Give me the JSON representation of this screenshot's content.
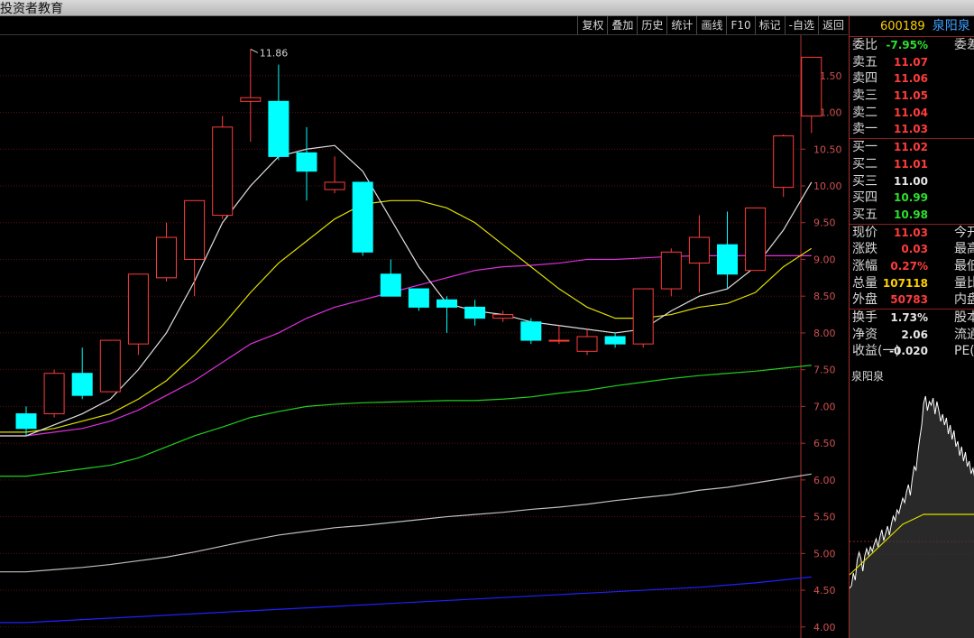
{
  "app": {
    "title": "投资者教育"
  },
  "toolbar": {
    "buttons": [
      "复权",
      "叠加",
      "历史",
      "统计",
      "画线",
      "F10",
      "标记",
      "-自选",
      "返回"
    ]
  },
  "chart": {
    "high_label": "11.86",
    "y_ticks": [
      "11.50",
      "11.00",
      "10.50",
      "10.00",
      "9.50",
      "9.00",
      "8.50",
      "8.00",
      "7.50",
      "7.00",
      "6.50",
      "6.00",
      "5.50",
      "5.00",
      "4.50",
      "4.00"
    ],
    "colors": {
      "up": "#ff3c3c",
      "down": "#00ffff",
      "ma5": "#e0e0e0",
      "ma10": "#e0e000",
      "ma20": "#e030e0",
      "ma60": "#20d020",
      "ma120": "#c0c0c0",
      "ma250": "#2020ff"
    }
  },
  "chart_data": {
    "type": "candlestick",
    "ylim": [
      3.85,
      12.05
    ],
    "candles": [
      {
        "o": 6.9,
        "h": 7.0,
        "l": 6.6,
        "c": 6.7
      },
      {
        "o": 6.9,
        "h": 7.5,
        "l": 6.85,
        "c": 7.45
      },
      {
        "o": 7.45,
        "h": 7.8,
        "l": 7.1,
        "c": 7.15
      },
      {
        "o": 7.2,
        "h": 7.9,
        "l": 7.2,
        "c": 7.9
      },
      {
        "o": 7.85,
        "h": 8.8,
        "l": 7.7,
        "c": 8.8
      },
      {
        "o": 8.75,
        "h": 9.5,
        "l": 8.7,
        "c": 9.3
      },
      {
        "o": 9.0,
        "h": 9.8,
        "l": 8.5,
        "c": 9.8
      },
      {
        "o": 9.6,
        "h": 10.95,
        "l": 9.55,
        "c": 10.8
      },
      {
        "o": 11.15,
        "h": 11.86,
        "l": 10.6,
        "c": 11.2
      },
      {
        "o": 11.15,
        "h": 11.65,
        "l": 10.35,
        "c": 10.4
      },
      {
        "o": 10.45,
        "h": 10.8,
        "l": 9.8,
        "c": 10.2
      },
      {
        "o": 9.95,
        "h": 10.4,
        "l": 9.9,
        "c": 10.05
      },
      {
        "o": 10.05,
        "h": 10.05,
        "l": 9.05,
        "c": 9.1
      },
      {
        "o": 8.8,
        "h": 9.0,
        "l": 8.5,
        "c": 8.5
      },
      {
        "o": 8.6,
        "h": 8.6,
        "l": 8.3,
        "c": 8.35
      },
      {
        "o": 8.45,
        "h": 8.5,
        "l": 8.0,
        "c": 8.35
      },
      {
        "o": 8.35,
        "h": 8.45,
        "l": 8.1,
        "c": 8.2
      },
      {
        "o": 8.2,
        "h": 8.3,
        "l": 8.15,
        "c": 8.25
      },
      {
        "o": 8.15,
        "h": 8.2,
        "l": 7.85,
        "c": 7.9
      },
      {
        "o": 7.9,
        "h": 8.1,
        "l": 7.85,
        "c": 7.9
      },
      {
        "o": 7.75,
        "h": 8.05,
        "l": 7.7,
        "c": 7.95
      },
      {
        "o": 7.95,
        "h": 8.0,
        "l": 7.8,
        "c": 7.85
      },
      {
        "o": 7.85,
        "h": 8.6,
        "l": 7.8,
        "c": 8.6
      },
      {
        "o": 8.6,
        "h": 9.15,
        "l": 8.5,
        "c": 9.1
      },
      {
        "o": 8.95,
        "h": 9.6,
        "l": 8.55,
        "c": 9.3
      },
      {
        "o": 9.2,
        "h": 9.65,
        "l": 8.6,
        "c": 8.8
      },
      {
        "o": 8.85,
        "h": 9.7,
        "l": 8.85,
        "c": 9.7
      },
      {
        "o": 9.98,
        "h": 10.7,
        "l": 9.85,
        "c": 10.68
      },
      {
        "o": 10.95,
        "h": 11.75,
        "l": 10.72,
        "c": 11.75
      }
    ],
    "ma5": [
      6.6,
      6.75,
      6.9,
      7.1,
      7.5,
      8.0,
      8.7,
      9.5,
      10.0,
      10.4,
      10.5,
      10.55,
      10.2,
      9.55,
      8.9,
      8.4,
      8.3,
      8.25,
      8.15,
      8.1,
      8.05,
      8.0,
      8.05,
      8.3,
      8.5,
      8.6,
      8.9,
      9.4,
      10.05
    ],
    "ma10": [
      6.65,
      6.7,
      6.8,
      6.9,
      7.1,
      7.35,
      7.7,
      8.1,
      8.55,
      8.95,
      9.25,
      9.55,
      9.75,
      9.8,
      9.8,
      9.7,
      9.5,
      9.2,
      8.9,
      8.6,
      8.35,
      8.2,
      8.2,
      8.25,
      8.35,
      8.4,
      8.55,
      8.9,
      9.15
    ],
    "ma20": [
      6.6,
      6.65,
      6.7,
      6.8,
      6.95,
      7.15,
      7.35,
      7.6,
      7.85,
      8.0,
      8.2,
      8.35,
      8.45,
      8.55,
      8.65,
      8.75,
      8.85,
      8.9,
      8.92,
      8.95,
      9.0,
      9.0,
      9.02,
      9.04,
      9.05,
      9.05,
      9.05,
      9.05,
      9.05
    ],
    "ma60": [
      6.05,
      6.1,
      6.15,
      6.2,
      6.3,
      6.45,
      6.6,
      6.72,
      6.85,
      6.93,
      7.0,
      7.03,
      7.05,
      7.06,
      7.07,
      7.08,
      7.08,
      7.1,
      7.13,
      7.18,
      7.22,
      7.28,
      7.33,
      7.38,
      7.42,
      7.45,
      7.48,
      7.52,
      7.56
    ],
    "ma120": [
      4.75,
      4.78,
      4.81,
      4.85,
      4.9,
      4.95,
      5.02,
      5.1,
      5.18,
      5.25,
      5.3,
      5.35,
      5.38,
      5.42,
      5.46,
      5.5,
      5.53,
      5.56,
      5.6,
      5.63,
      5.67,
      5.72,
      5.76,
      5.8,
      5.86,
      5.9,
      5.96,
      6.02,
      6.08
    ],
    "ma250": [
      4.06,
      4.08,
      4.1,
      4.12,
      4.14,
      4.16,
      4.18,
      4.2,
      4.22,
      4.24,
      4.26,
      4.28,
      4.3,
      4.32,
      4.34,
      4.36,
      4.38,
      4.4,
      4.42,
      4.44,
      4.46,
      4.48,
      4.5,
      4.52,
      4.54,
      4.57,
      4.6,
      4.64,
      4.68
    ]
  },
  "quote": {
    "code": "600189",
    "name": "泉阳泉",
    "rows": [
      {
        "label": "委比",
        "value": "-7.95%",
        "color": "green",
        "extra": "委差"
      },
      {
        "label": "卖五",
        "value": "11.07",
        "color": "red",
        "extra": ""
      },
      {
        "label": "卖四",
        "value": "11.06",
        "color": "red",
        "extra": ""
      },
      {
        "label": "卖三",
        "value": "11.05",
        "color": "red",
        "extra": ""
      },
      {
        "label": "卖二",
        "value": "11.04",
        "color": "red",
        "extra": ""
      },
      {
        "label": "卖一",
        "value": "11.03",
        "color": "red",
        "extra": ""
      },
      {
        "label": "买一",
        "value": "11.02",
        "color": "red",
        "extra": "",
        "sep": true
      },
      {
        "label": "买二",
        "value": "11.01",
        "color": "red",
        "extra": ""
      },
      {
        "label": "买三",
        "value": "11.00",
        "color": "white",
        "extra": ""
      },
      {
        "label": "买四",
        "value": "10.99",
        "color": "green",
        "extra": ""
      },
      {
        "label": "买五",
        "value": "10.98",
        "color": "green",
        "extra": ""
      },
      {
        "label": "现价",
        "value": "11.03",
        "color": "red",
        "extra": "今开",
        "sep": true
      },
      {
        "label": "涨跌",
        "value": "0.03",
        "color": "red",
        "extra": "最高"
      },
      {
        "label": "涨幅",
        "value": "0.27%",
        "color": "red",
        "extra": "最低"
      },
      {
        "label": "总量",
        "value": "107118",
        "color": "yellow",
        "extra": "量比"
      },
      {
        "label": "外盘",
        "value": "50783",
        "color": "red",
        "extra": "内盘"
      },
      {
        "label": "换手",
        "value": "1.73%",
        "color": "white",
        "extra": "股本",
        "sep": true
      },
      {
        "label": "净资",
        "value": "2.06",
        "color": "white",
        "extra": "流通"
      },
      {
        "label": "收益(一)",
        "value": "-0.020",
        "color": "white",
        "extra": "PE(动)"
      }
    ],
    "mini_title": "泉阳泉",
    "mini": {
      "price_line": [
        55,
        58,
        72,
        64,
        86,
        95,
        88,
        74,
        91,
        99,
        92,
        101,
        96,
        104,
        110,
        101,
        112,
        120,
        108,
        116,
        124,
        114,
        126,
        135,
        130,
        142,
        138,
        147,
        155,
        150,
        162,
        170,
        158,
        176,
        190,
        186,
        206,
        222,
        236,
        260,
        268,
        252,
        262,
        258,
        266,
        248,
        262,
        252,
        240,
        248,
        236,
        244,
        226,
        236,
        220,
        230,
        212,
        218,
        202,
        212,
        196,
        206,
        190,
        196,
        182,
        188,
        176
      ],
      "avg_line": [
        70,
        72,
        74,
        76,
        78,
        80,
        82,
        84,
        86,
        88,
        90,
        92,
        94,
        96,
        98,
        100,
        102,
        104,
        106,
        108,
        110,
        112,
        114,
        116,
        118,
        120,
        122,
        124,
        126,
        127,
        128,
        129,
        130,
        131,
        132,
        133,
        134,
        135,
        136,
        137,
        137,
        137,
        137,
        137,
        137,
        137,
        137,
        137,
        137,
        137,
        137,
        137,
        137,
        137,
        137,
        137,
        137,
        137,
        137,
        137,
        137,
        137,
        137,
        137,
        137,
        137,
        137
      ]
    }
  }
}
